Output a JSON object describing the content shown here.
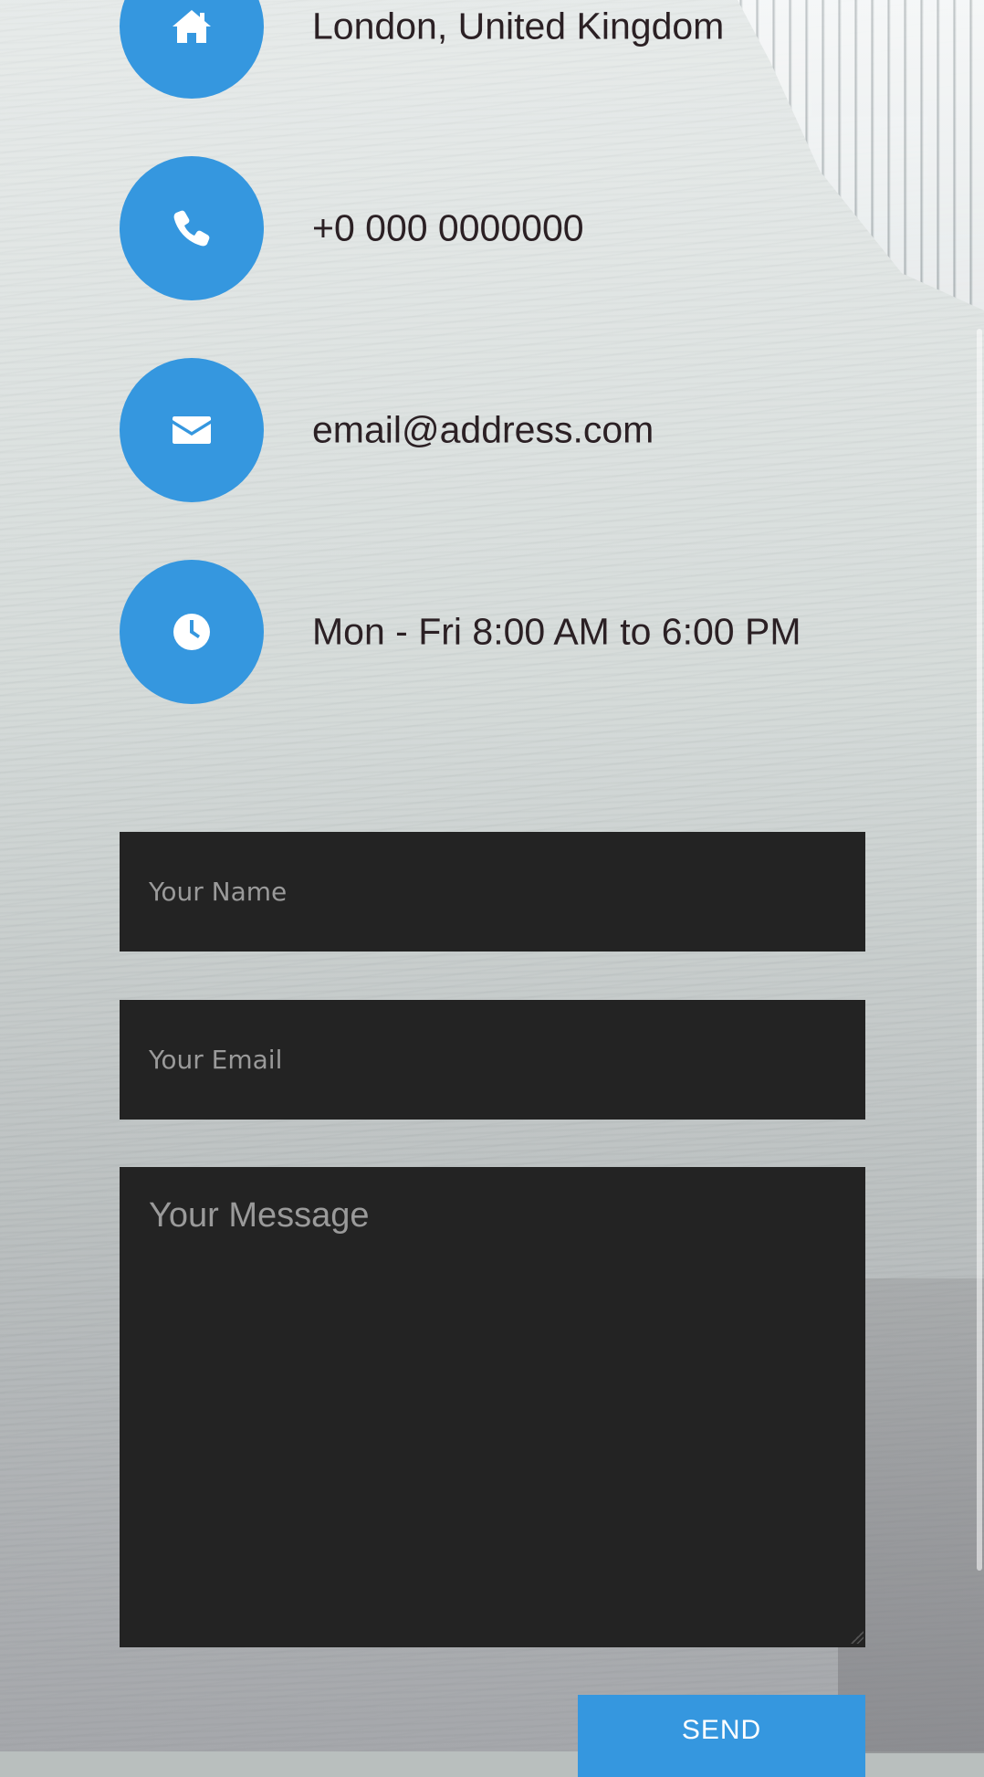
{
  "contact": {
    "items": [
      {
        "icon": "home-icon",
        "text": "London, United Kingdom"
      },
      {
        "icon": "phone-icon",
        "text": "+0 000 0000000"
      },
      {
        "icon": "envelope-icon",
        "text": "email@address.com"
      },
      {
        "icon": "clock-icon",
        "text": "Mon - Fri 8:00 AM to 6:00 PM"
      }
    ]
  },
  "form": {
    "name_placeholder": "Your Name",
    "email_placeholder": "Your Email",
    "message_placeholder": "Your Message",
    "send_label": "SEND"
  },
  "colors": {
    "accent": "#3597df",
    "field_bg": "#232323",
    "text": "#2b2024"
  }
}
